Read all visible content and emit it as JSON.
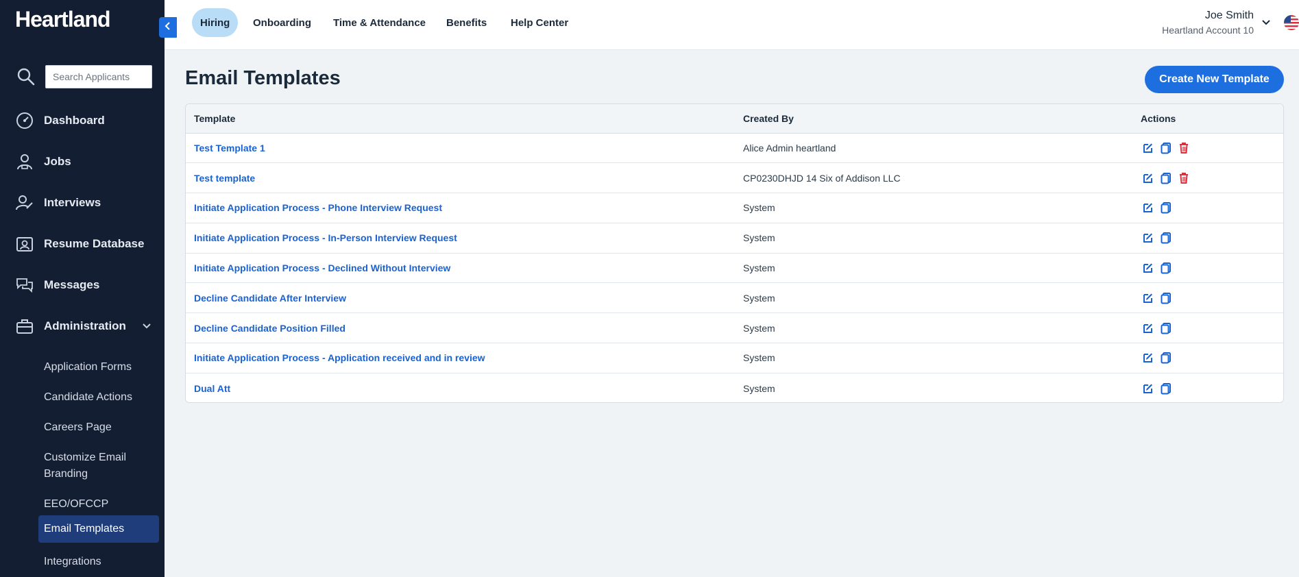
{
  "brand": {
    "logo": "Heartland"
  },
  "search": {
    "placeholder": "Search Applicants"
  },
  "sidebar": {
    "items": [
      {
        "label": "Dashboard",
        "icon": "dashboard-gauge-icon"
      },
      {
        "label": "Jobs",
        "icon": "jobs-person-icon"
      },
      {
        "label": "Interviews",
        "icon": "interviews-person-pen-icon"
      },
      {
        "label": "Resume Database",
        "icon": "resume-database-icon"
      },
      {
        "label": "Messages",
        "icon": "messages-chat-icon"
      },
      {
        "label": "Administration",
        "icon": "administration-toolbox-icon",
        "expanded": true
      }
    ],
    "sub_items": [
      {
        "label": "Application Forms",
        "active": false
      },
      {
        "label": "Candidate Actions",
        "active": false
      },
      {
        "label": "Careers Page",
        "active": false
      },
      {
        "label": "Customize Email Branding",
        "active": false
      },
      {
        "label": "EEO/OFCCP",
        "active": false
      },
      {
        "label": "Email Templates",
        "active": true
      },
      {
        "label": "Integrations",
        "active": false
      }
    ]
  },
  "topnav": {
    "tabs": [
      {
        "label": "Hiring",
        "active": true
      },
      {
        "label": "Onboarding",
        "active": false
      },
      {
        "label": "Time & Attendance",
        "active": false
      },
      {
        "label": "Benefits",
        "active": false
      },
      {
        "label": "Help Center",
        "active": false
      }
    ],
    "user": {
      "name": "Joe Smith",
      "account": "Heartland Account 10"
    }
  },
  "main": {
    "title": "Email Templates",
    "create_button": "Create New Template",
    "table": {
      "headers": {
        "template": "Template",
        "created_by": "Created By",
        "actions": "Actions"
      },
      "rows": [
        {
          "template": "Test Template 1",
          "created_by": "Alice Admin heartland",
          "deletable": true
        },
        {
          "template": "Test template",
          "created_by": "CP0230DHJD 14 Six of Addison LLC",
          "deletable": true
        },
        {
          "template": "Initiate Application Process - Phone Interview Request",
          "created_by": "System",
          "deletable": false
        },
        {
          "template": "Initiate Application Process - In-Person Interview Request",
          "created_by": "System",
          "deletable": false
        },
        {
          "template": "Initiate Application Process - Declined Without Interview",
          "created_by": "System",
          "deletable": false
        },
        {
          "template": "Decline Candidate After Interview",
          "created_by": "System",
          "deletable": false
        },
        {
          "template": "Decline Candidate Position Filled",
          "created_by": "System",
          "deletable": false
        },
        {
          "template": "Initiate Application Process - Application received and in review",
          "created_by": "System",
          "deletable": false
        },
        {
          "template": "Dual Att",
          "created_by": "System",
          "deletable": false
        }
      ]
    }
  },
  "colors": {
    "sidebar_bg": "#141e33",
    "accent": "#1d6fe0",
    "link": "#1a62cf",
    "delete": "#d9303e",
    "active_tab": "#b9dcf7"
  }
}
